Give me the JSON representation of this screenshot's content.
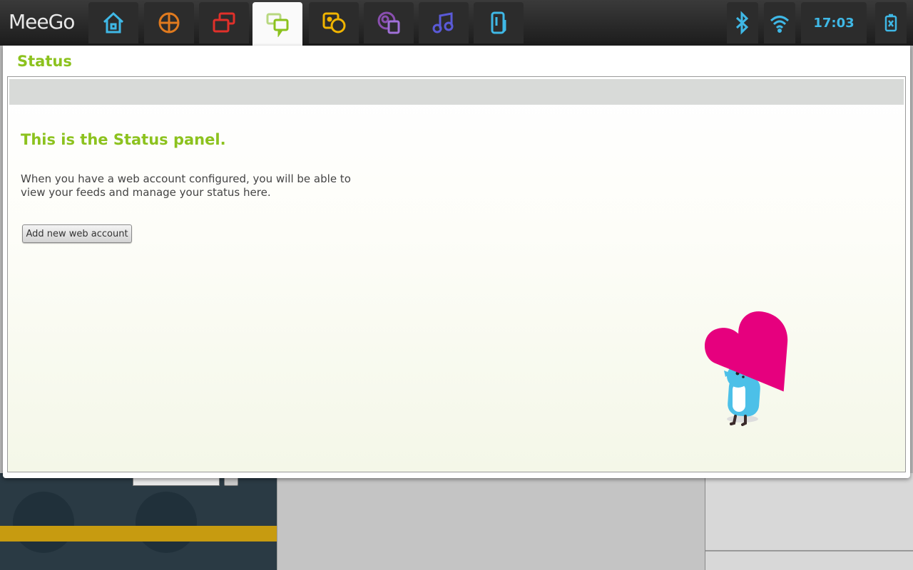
{
  "topbar": {
    "logo": "MeeGo",
    "clock": "17:03",
    "tabs": [
      {
        "id": "myzone",
        "icon": "home-icon",
        "color": "#3fb8e6"
      },
      {
        "id": "applications",
        "icon": "apps-grid-icon",
        "color": "#e07a1e"
      },
      {
        "id": "zones",
        "icon": "windows-icon",
        "color": "#e0302a"
      },
      {
        "id": "status",
        "icon": "chat-bubbles-icon",
        "color": "#8cc21e",
        "active": true
      },
      {
        "id": "people",
        "icon": "people-icon",
        "color": "#f0b400"
      },
      {
        "id": "internet",
        "icon": "web-icon",
        "color": "#8a4fb0"
      },
      {
        "id": "media",
        "icon": "music-note-icon",
        "color": "#5a5ad8"
      },
      {
        "id": "devices",
        "icon": "devices-icon",
        "color": "#3fb8e6"
      }
    ],
    "system_icons": [
      "bluetooth-icon",
      "wifi-icon",
      "battery-icon"
    ]
  },
  "panel": {
    "title": "Status",
    "heading": "This is the Status panel.",
    "description": "When you have a web account configured, you will be able to view your feeds and manage your status here.",
    "button_label": "Add new web account"
  },
  "colors": {
    "accent": "#8cc21e",
    "heart": "#e6007e",
    "bird": "#4cc0e8"
  }
}
